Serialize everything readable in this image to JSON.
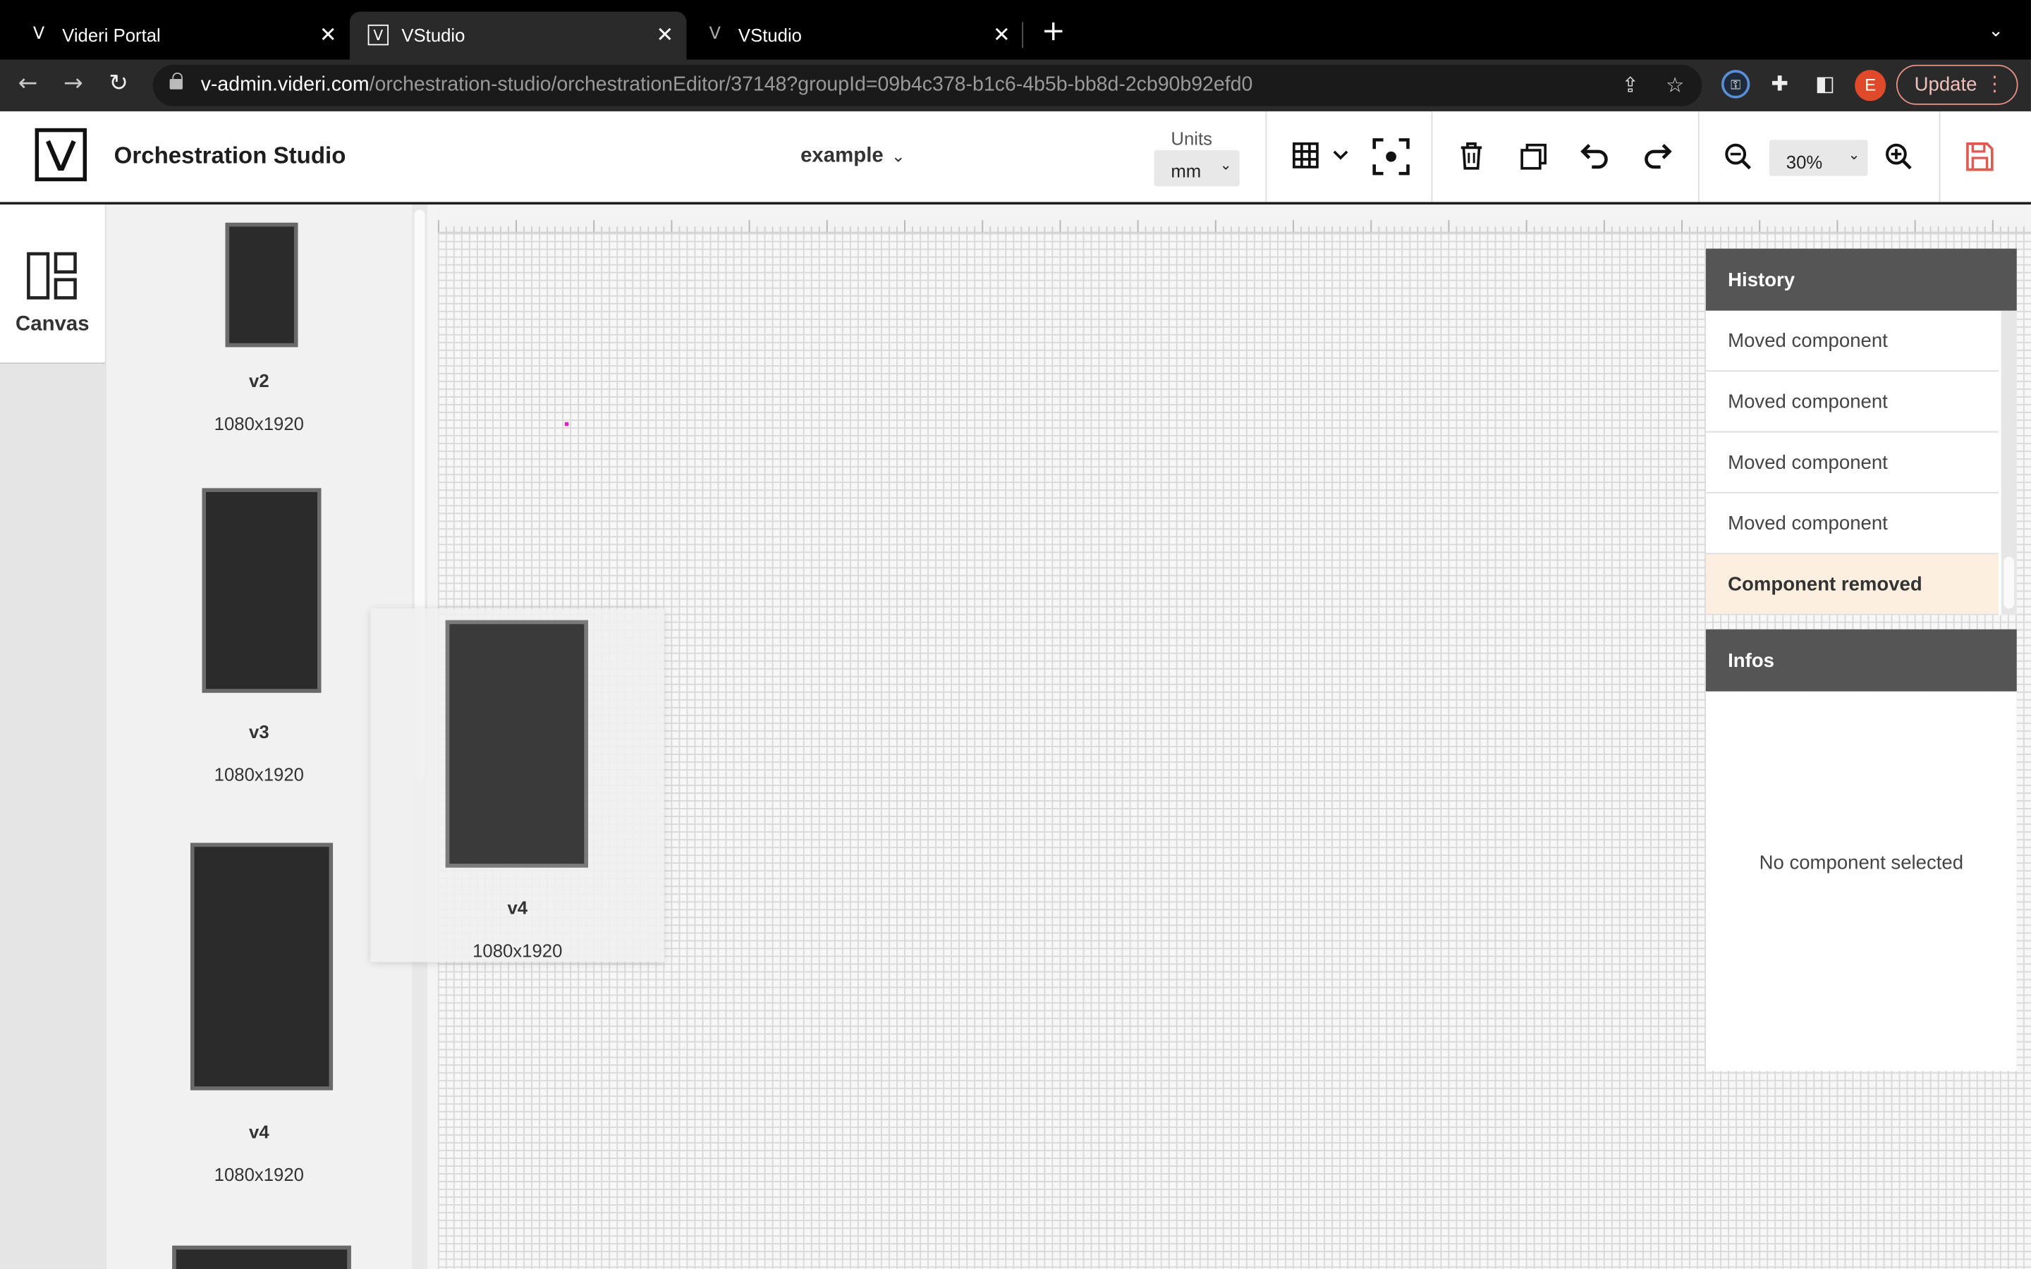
{
  "browser": {
    "tabs": [
      {
        "title": "Videri Portal",
        "favicon": "videri-v-icon",
        "active": false
      },
      {
        "title": "VStudio",
        "favicon": "vstudio-icon",
        "active": true
      },
      {
        "title": "VStudio",
        "favicon": "vstudio-icon",
        "active": false
      }
    ],
    "url_host": "v-admin.videri.com",
    "url_path": "/orchestration-studio/orchestrationEditor/37148?groupId=09b4c378-b1c6-4b5b-bb8d-2cb90b92efd0",
    "profile_initial": "E",
    "update_label": "Update",
    "colors": {
      "update_border": "#e88f86",
      "avatar": "#e04a2a"
    }
  },
  "header": {
    "app_title": "Orchestration Studio",
    "project_name": "example",
    "units_label": "Units",
    "units_value": "mm",
    "zoom_value": "30%",
    "colors": {
      "save_icon": "#e05a50"
    }
  },
  "leftnav": {
    "canvas_label": "Canvas"
  },
  "components": [
    {
      "name": "v2",
      "resolution": "1080x1920"
    },
    {
      "name": "v3",
      "resolution": "1080x1920"
    },
    {
      "name": "v4",
      "resolution": "1080x1920"
    }
  ],
  "drag_ghost": {
    "name": "v4",
    "resolution": "1080x1920"
  },
  "history": {
    "title": "History",
    "items": [
      {
        "label": "Moved component"
      },
      {
        "label": "Moved component"
      },
      {
        "label": "Moved component"
      },
      {
        "label": "Moved component"
      },
      {
        "label": "Component removed",
        "current": true
      }
    ],
    "colors": {
      "current_bg": "#fdefdf",
      "header_bg": "#555555"
    }
  },
  "infos": {
    "title": "Infos",
    "empty_text": "No component selected"
  }
}
